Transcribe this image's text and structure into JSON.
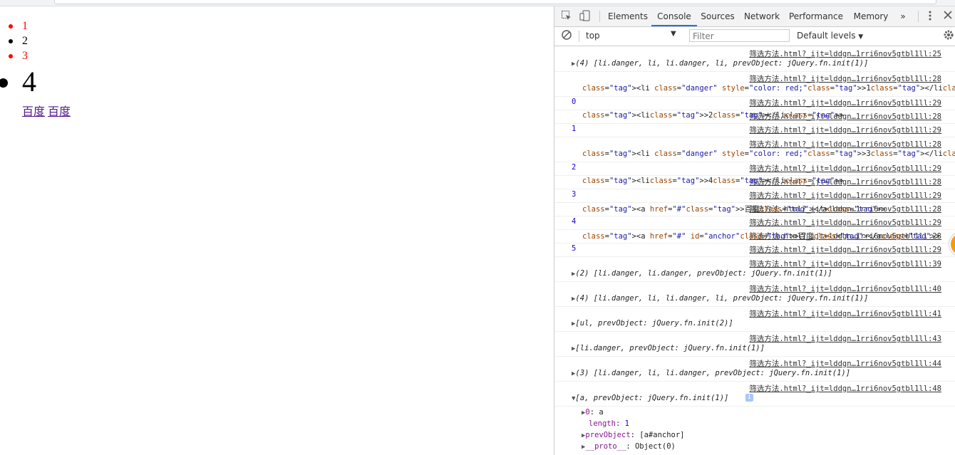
{
  "page": {
    "items": [
      {
        "text": "1",
        "color": "#ff0000"
      },
      {
        "text": "2",
        "color": "#000000"
      },
      {
        "text": "3",
        "color": "#ff0000"
      },
      {
        "text": "4",
        "color": "#000000"
      }
    ],
    "links": [
      "百度",
      "百度"
    ]
  },
  "devtools": {
    "tabs": [
      "Elements",
      "Console",
      "Sources",
      "Network",
      "Performance",
      "Memory"
    ],
    "more_tabs_icon": "»",
    "context": "top",
    "filter_placeholder": "Filter",
    "levels": "Default levels",
    "accent": "#1a73e8"
  },
  "console": {
    "messages": [
      {
        "src": "筛选方法.html?_ijt=lddgn…1rri6nov5gtbl1ll:25",
        "value": "▶(4) [li.danger, li, li.danger, li, prevObject: jQuery.fn.init(1)]"
      },
      {
        "src": "筛选方法.html?_ijt=lddgn…1rri6nov5gtbl1ll:28",
        "value": "<li class=\"danger\" style=\"color: red;\">1</li>"
      },
      {
        "src": "筛选方法.html?_ijt=lddgn…1rri6nov5gtbl1ll:29",
        "value": "0"
      },
      {
        "src": "筛选方法.html?_ijt=lddgn…1rri6nov5gtbl1ll:28",
        "value": "<li>2</li>"
      },
      {
        "src": "筛选方法.html?_ijt=lddgn…1rri6nov5gtbl1ll:29",
        "value": "1"
      },
      {
        "src": "筛选方法.html?_ijt=lddgn…1rri6nov5gtbl1ll:28",
        "value": "<li class=\"danger\" style=\"color: red;\">3</li>"
      },
      {
        "src": "筛选方法.html?_ijt=lddgn…1rri6nov5gtbl1ll:29",
        "value": "2"
      },
      {
        "src": "筛选方法.html?_ijt=lddgn…1rri6nov5gtbl1ll:28",
        "value": "<li>4</li>"
      },
      {
        "src": "筛选方法.html?_ijt=lddgn…1rri6nov5gtbl1ll:29",
        "value": "3"
      },
      {
        "src": "筛选方法.html?_ijt=lddgn…1rri6nov5gtbl1ll:28",
        "value": "<a href=\"#\">百度</a>"
      },
      {
        "src": "筛选方法.html?_ijt=lddgn…1rri6nov5gtbl1ll:29",
        "value": "4"
      },
      {
        "src": "筛选方法.html?_ijt=lddgn…1rri6nov5gtbl1ll:28",
        "value": "<a href=\"#\" id=\"anchor\">百度</a>"
      },
      {
        "src": "筛选方法.html?_ijt=lddgn…1rri6nov5gtbl1ll:29",
        "value": "5"
      },
      {
        "src": "筛选方法.html?_ijt=lddgn…1rri6nov5gtbl1ll:39",
        "value": "▶(2) [li.danger, li.danger, prevObject: jQuery.fn.init(1)]"
      },
      {
        "src": "筛选方法.html?_ijt=lddgn…1rri6nov5gtbl1ll:40",
        "value": "▶(4) [li.danger, li, li.danger, li, prevObject: jQuery.fn.init(1)]"
      },
      {
        "src": "筛选方法.html?_ijt=lddgn…1rri6nov5gtbl1ll:41",
        "value": "▶[ul, prevObject: jQuery.fn.init(2)]"
      },
      {
        "src": "筛选方法.html?_ijt=lddgn…1rri6nov5gtbl1ll:43",
        "value": "▶[li.danger, prevObject: jQuery.fn.init(1)]"
      },
      {
        "src": "筛选方法.html?_ijt=lddgn…1rri6nov5gtbl1ll:44",
        "value": "▶(3) [li.danger, li, li.danger, prevObject: jQuery.fn.init(1)]"
      },
      {
        "src": "筛选方法.html?_ijt=lddgn…1rri6nov5gtbl1ll:48",
        "value": "▼[a, prevObject: jQuery.fn.init(1)]"
      }
    ],
    "expanded": [
      "▶0: a",
      "length: 1",
      "▶prevObject: [a#anchor]",
      "▶__proto__: Object(0)"
    ],
    "info_badge": "i",
    "orb_text": "8"
  }
}
